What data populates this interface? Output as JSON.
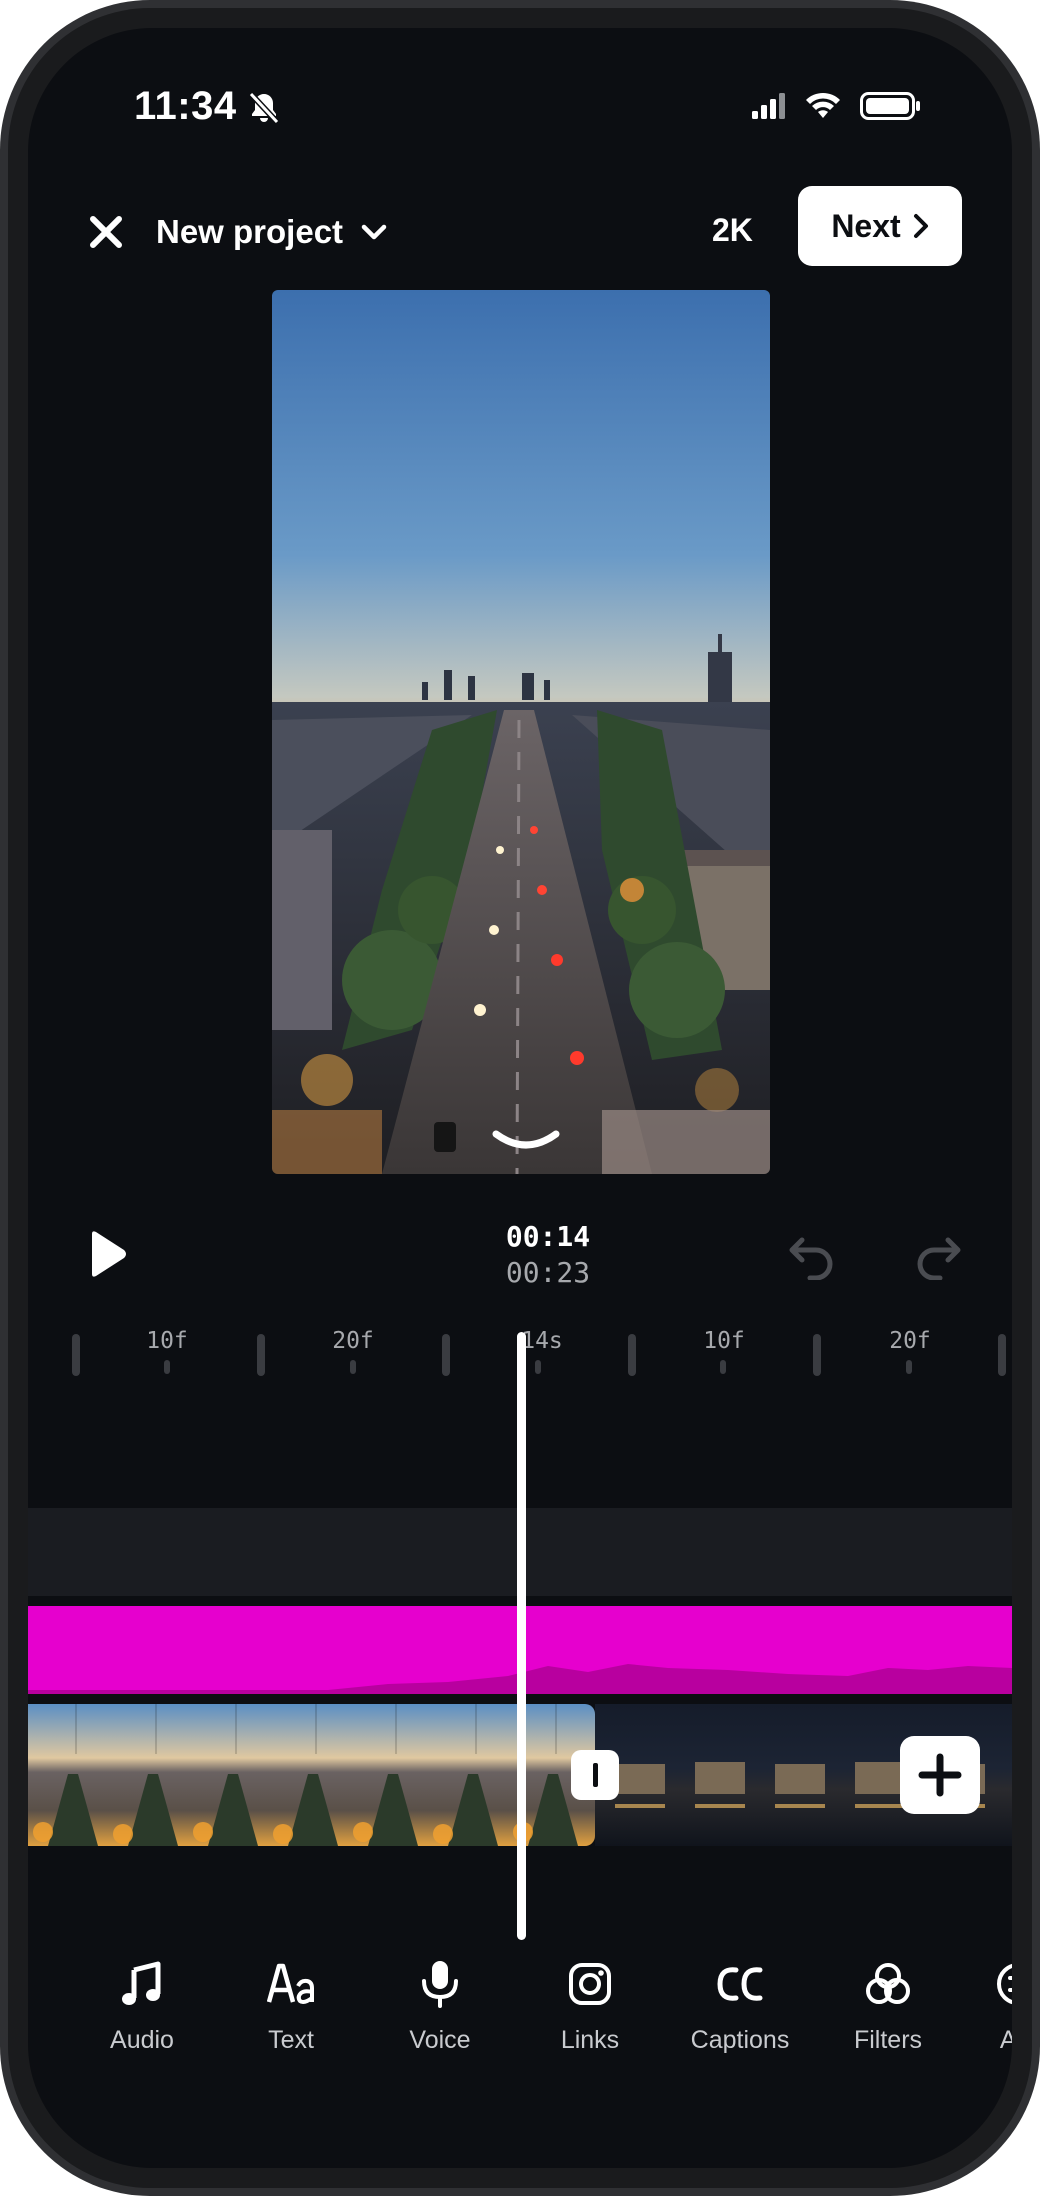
{
  "status_bar": {
    "time": "11:34",
    "icons": [
      "bell-off-icon",
      "cellular-signal-icon",
      "wifi-icon",
      "battery-icon"
    ]
  },
  "header": {
    "project_title": "New project",
    "resolution": "2K",
    "next_label": "Next"
  },
  "playback": {
    "current_time": "00:14",
    "total_time": "00:23"
  },
  "ruler": {
    "labels": [
      "10f",
      "20f",
      "14s",
      "10f",
      "20f"
    ]
  },
  "toolbar": {
    "items": [
      {
        "label": "Audio",
        "icon": "music-note-icon"
      },
      {
        "label": "Text",
        "icon": "text-aa-icon"
      },
      {
        "label": "Voice",
        "icon": "microphone-icon"
      },
      {
        "label": "Links",
        "icon": "instagram-icon"
      },
      {
        "label": "Captions",
        "icon": "captions-cc-icon"
      },
      {
        "label": "Filters",
        "icon": "filters-icon"
      },
      {
        "label": "Adj",
        "icon": "adjust-icon"
      }
    ]
  },
  "colors": {
    "background": "#0c0e12",
    "audio_track": "#e600ce",
    "accent": "#ffffff"
  }
}
